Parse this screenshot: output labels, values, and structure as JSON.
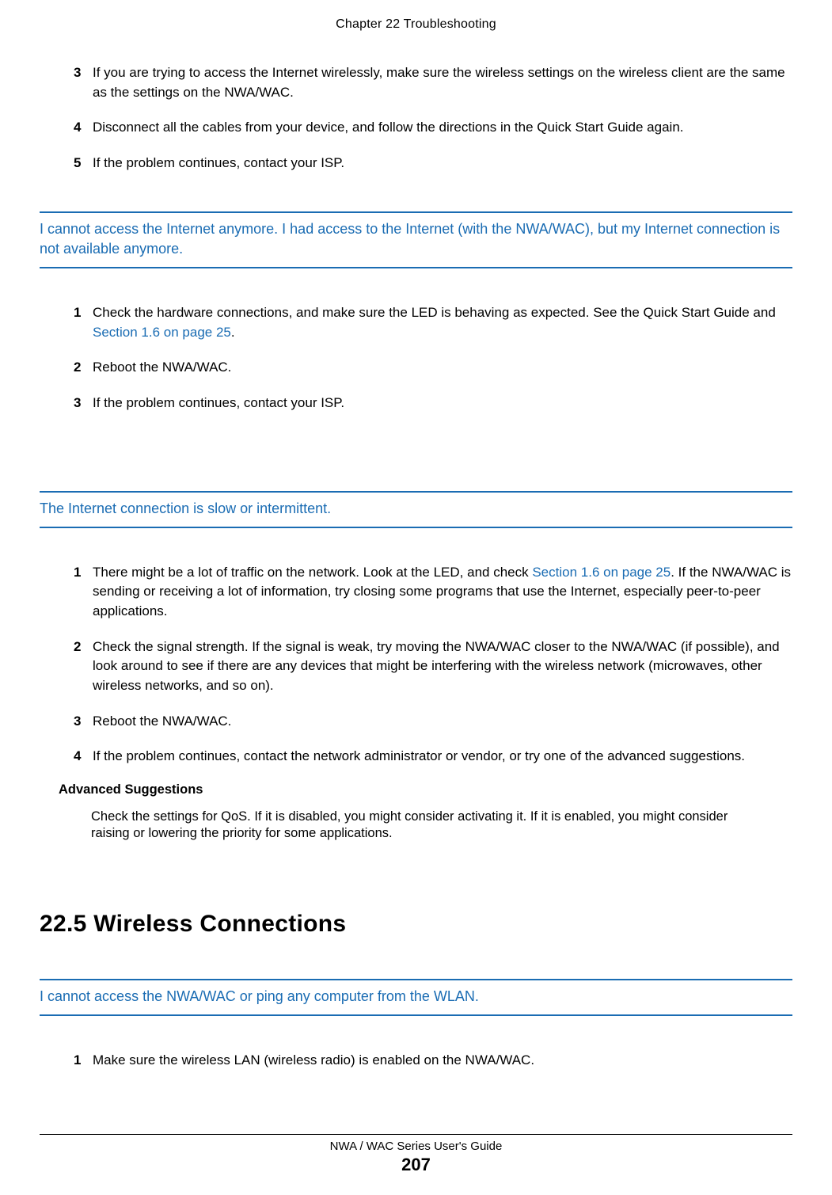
{
  "header": {
    "chapter": "Chapter 22 Troubleshooting"
  },
  "topList": [
    {
      "num": "3",
      "text": "If you are trying to access the Internet wirelessly, make sure the wireless settings on the wireless client are the same as the settings on the NWA/WAC."
    },
    {
      "num": "4",
      "text": "Disconnect all the cables from your device, and follow the directions in the Quick Start Guide again."
    },
    {
      "num": "5",
      "text": "If the problem continues, contact your ISP."
    }
  ],
  "topicA": {
    "title": "I cannot access the Internet anymore. I had access to the Internet (with the NWA/WAC), but my Internet connection is not available anymore.",
    "items": [
      {
        "num": "1",
        "pre": "Check the hardware connections, and make sure the LED is behaving as expected. See the Quick Start Guide and ",
        "link": "Section 1.6 on page 25",
        "post": "."
      },
      {
        "num": "2",
        "pre": "Reboot the NWA/WAC.",
        "link": "",
        "post": ""
      },
      {
        "num": "3",
        "pre": "If the problem continues, contact your ISP.",
        "link": "",
        "post": ""
      }
    ]
  },
  "topicB": {
    "title": "The Internet connection is slow or intermittent.",
    "items": [
      {
        "num": "1",
        "pre": "There might be a lot of traffic on the network. Look at the LED, and check ",
        "link": "Section 1.6 on page 25",
        "post": ". If the NWA/WAC is sending or receiving a lot of information, try closing some programs that use the Internet, especially peer-to-peer applications."
      },
      {
        "num": "2",
        "pre": "Check the signal strength. If the signal is weak, try moving the NWA/WAC closer to the NWA/WAC (if possible), and look around to see if there are any devices that might be interfering with the wireless network (microwaves, other wireless networks, and so on).",
        "link": "",
        "post": ""
      },
      {
        "num": "3",
        "pre": "Reboot the NWA/WAC.",
        "link": "",
        "post": ""
      },
      {
        "num": "4",
        "pre": "If the problem continues, contact the network administrator or vendor, or try one of the advanced suggestions.",
        "link": "",
        "post": ""
      }
    ],
    "advancedHeading": "Advanced Suggestions",
    "advancedText": "Check the settings for QoS. If it is disabled, you might consider activating it. If it is enabled, you might consider raising or lowering the priority for some applications."
  },
  "section": {
    "heading": "22.5  Wireless Connections"
  },
  "topicC": {
    "title": "I cannot access the NWA/WAC or ping any computer from the WLAN.",
    "items": [
      {
        "num": "1",
        "text": "Make sure the wireless LAN (wireless radio) is enabled on the NWA/WAC."
      }
    ]
  },
  "footer": {
    "guide": "NWA / WAC Series User's Guide",
    "page": "207"
  }
}
